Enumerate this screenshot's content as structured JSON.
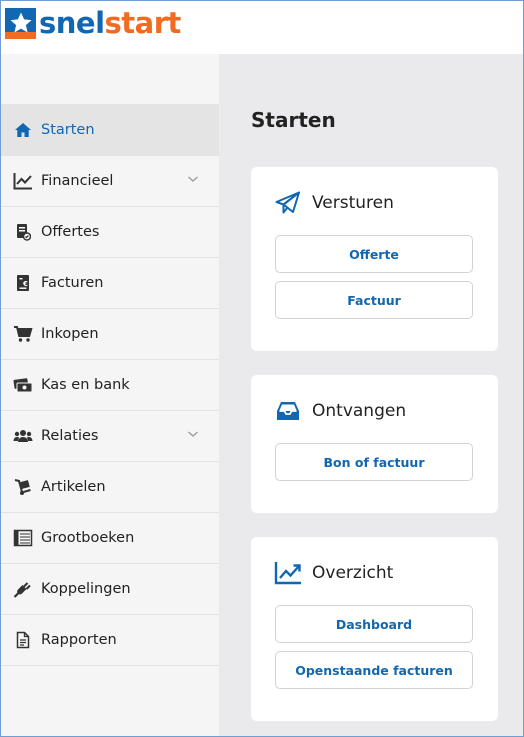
{
  "brand": {
    "snel": "snel",
    "start": "start"
  },
  "sidebar": {
    "items": [
      {
        "label": "Starten",
        "icon": "home-icon"
      },
      {
        "label": "Financieel",
        "icon": "line-chart-icon"
      },
      {
        "label": "Offertes",
        "icon": "offer-document-icon"
      },
      {
        "label": "Facturen",
        "icon": "invoice-icon"
      },
      {
        "label": "Inkopen",
        "icon": "shopping-cart-icon"
      },
      {
        "label": "Kas en bank",
        "icon": "money-icon"
      },
      {
        "label": "Relaties",
        "icon": "users-icon"
      },
      {
        "label": "Artikelen",
        "icon": "hand-truck-icon"
      },
      {
        "label": "Grootboeken",
        "icon": "ledger-icon"
      },
      {
        "label": "Koppelingen",
        "icon": "plug-icon"
      },
      {
        "label": "Rapporten",
        "icon": "report-icon"
      }
    ]
  },
  "main": {
    "title": "Starten",
    "cards": [
      {
        "title": "Versturen",
        "icon": "paper-plane-icon",
        "buttons": [
          "Offerte",
          "Factuur"
        ]
      },
      {
        "title": "Ontvangen",
        "icon": "inbox-icon",
        "buttons": [
          "Bon of factuur"
        ]
      },
      {
        "title": "Overzicht",
        "icon": "chart-overview-icon",
        "buttons": [
          "Dashboard",
          "Openstaande facturen"
        ]
      }
    ]
  },
  "colors": {
    "accent": "#1167b1",
    "brand_orange": "#f26b21",
    "sidebar_bg": "#f5f5f5",
    "main_bg": "#eaeaed"
  }
}
